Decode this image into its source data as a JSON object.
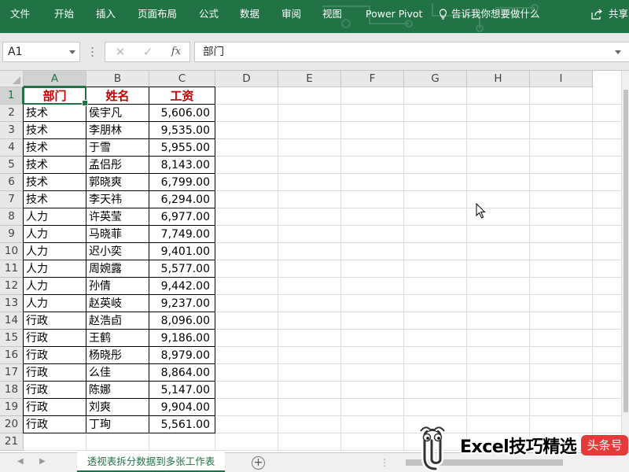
{
  "ribbon": {
    "tabs": [
      "文件",
      "开始",
      "插入",
      "页面布局",
      "公式",
      "数据",
      "审阅",
      "视图",
      "Power Pivot"
    ],
    "tell_me": "告诉我你想要做什么",
    "share": "共享"
  },
  "formula_bar": {
    "name_box": "A1",
    "cancel_symbol": "✕",
    "enter_symbol": "✓",
    "fx_label": "fx",
    "content": "部门"
  },
  "columns": [
    "A",
    "B",
    "C",
    "D",
    "E",
    "F",
    "G",
    "H",
    "I"
  ],
  "rows": [
    "1",
    "2",
    "3",
    "4",
    "5",
    "6",
    "7",
    "8",
    "9",
    "10",
    "11",
    "12",
    "13",
    "14",
    "15",
    "16",
    "17",
    "18",
    "19",
    "20",
    "21"
  ],
  "table": {
    "headers": [
      "部门",
      "姓名",
      "工资"
    ],
    "rows": [
      [
        "技术",
        "侯宇凡",
        "5,606.00"
      ],
      [
        "技术",
        "李朋林",
        "9,535.00"
      ],
      [
        "技术",
        "于雪",
        "5,955.00"
      ],
      [
        "技术",
        "孟侣彤",
        "8,143.00"
      ],
      [
        "技术",
        "郭晓爽",
        "6,799.00"
      ],
      [
        "技术",
        "李天祎",
        "6,294.00"
      ],
      [
        "人力",
        "许英莹",
        "6,977.00"
      ],
      [
        "人力",
        "马晓菲",
        "7,749.00"
      ],
      [
        "人力",
        "迟小奕",
        "9,401.00"
      ],
      [
        "人力",
        "周婉露",
        "5,577.00"
      ],
      [
        "人力",
        "孙倩",
        "9,442.00"
      ],
      [
        "人力",
        "赵英岐",
        "9,237.00"
      ],
      [
        "行政",
        "赵浩卣",
        "8,096.00"
      ],
      [
        "行政",
        "王鹤",
        "9,186.00"
      ],
      [
        "行政",
        "杨晓彤",
        "8,979.00"
      ],
      [
        "行政",
        "么佳",
        "8,864.00"
      ],
      [
        "行政",
        "陈娜",
        "5,147.00"
      ],
      [
        "行政",
        "刘爽",
        "9,904.00"
      ],
      [
        "行政",
        "丁珣",
        "5,561.00"
      ]
    ]
  },
  "sheet": {
    "tab_name": "透视表拆分数据到多张工作表",
    "add_symbol": "+",
    "prev_symbol": "◀",
    "next_symbol": "▶"
  },
  "watermark": {
    "text": "Excel技巧精选",
    "badge": "头条号"
  },
  "colors": {
    "excel_green": "#217346",
    "header_red": "#c00000",
    "badge_red": "#e43a3a"
  }
}
